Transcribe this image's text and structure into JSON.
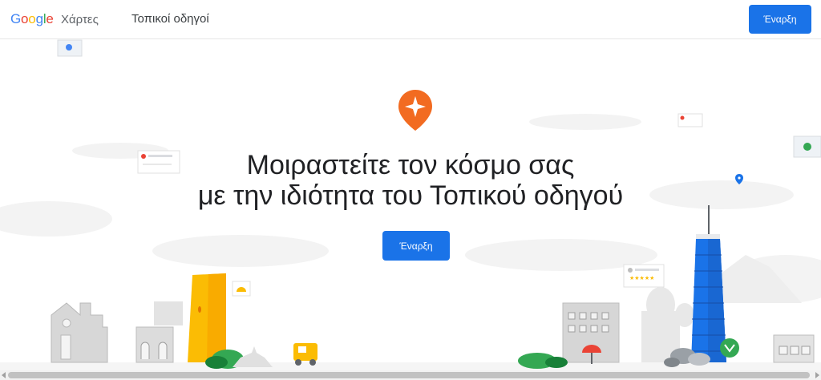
{
  "header": {
    "logo_letters": [
      "G",
      "o",
      "o",
      "g",
      "l",
      "e"
    ],
    "product_name": "Χάρτες",
    "nav_title": "Τοπικοί οδηγοί",
    "start_button": "Έναρξη"
  },
  "hero": {
    "title_line1": "Μοιραστείτε τον κόσμο σας",
    "title_line2": "με την ιδιότητα του Τοπικού οδηγού",
    "start_button": "Έναρξη"
  },
  "colors": {
    "primary_blue": "#1a73e8",
    "brand_orange": "#f26b21",
    "building_yellow": "#fbbc04",
    "tower_blue": "#1a73e8",
    "tree_green": "#34a853"
  },
  "icons": {
    "local_guides_pin": "local-guides-pin-icon",
    "map_pin": "map-pin-icon"
  }
}
